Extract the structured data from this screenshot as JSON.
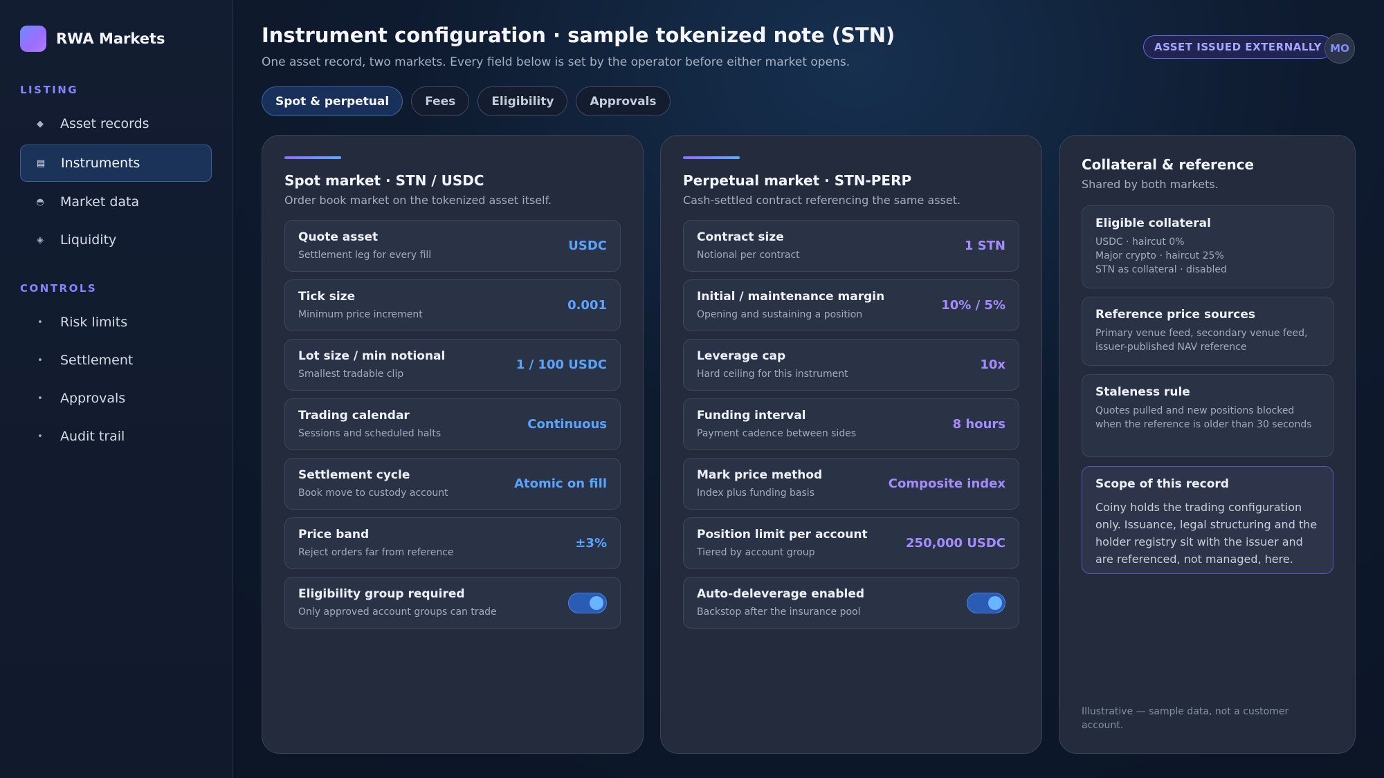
{
  "brand": {
    "name": "RWA Markets"
  },
  "sidebar": {
    "sections": [
      {
        "label": "LISTING",
        "items": [
          {
            "label": "Asset records",
            "icon": "diamond-icon"
          },
          {
            "label": "Instruments",
            "icon": "list-icon",
            "active": true
          },
          {
            "label": "Market data",
            "icon": "half-circle-icon"
          },
          {
            "label": "Liquidity",
            "icon": "diamond-outline-icon"
          }
        ]
      },
      {
        "label": "CONTROLS",
        "items": [
          {
            "label": "Risk limits",
            "icon": "dot-icon"
          },
          {
            "label": "Settlement",
            "icon": "dot-icon"
          },
          {
            "label": "Approvals",
            "icon": "dot-icon"
          },
          {
            "label": "Audit trail",
            "icon": "dot-icon"
          }
        ]
      }
    ]
  },
  "header": {
    "title": "Instrument configuration · sample tokenized note (STN)",
    "subtitle": "One asset record, two markets. Every field below is set by the operator before either market opens.",
    "badge": "ASSET ISSUED EXTERNALLY",
    "avatar": "MO"
  },
  "tabs": [
    {
      "label": "Spot & perpetual",
      "active": true
    },
    {
      "label": "Fees"
    },
    {
      "label": "Eligibility"
    },
    {
      "label": "Approvals"
    }
  ],
  "spot": {
    "title": "Spot market · STN / USDC",
    "subtitle": "Order book market on the tokenized asset itself.",
    "rows": [
      {
        "label": "Quote asset",
        "desc": "Settlement leg for every fill",
        "value": "USDC"
      },
      {
        "label": "Tick size",
        "desc": "Minimum price increment",
        "value": "0.001"
      },
      {
        "label": "Lot size / min notional",
        "desc": "Smallest tradable clip",
        "value": "1 / 100 USDC"
      },
      {
        "label": "Trading calendar",
        "desc": "Sessions and scheduled halts",
        "value": "Continuous"
      },
      {
        "label": "Settlement cycle",
        "desc": "Book move to custody account",
        "value": "Atomic on fill"
      },
      {
        "label": "Price band",
        "desc": "Reject orders far from reference",
        "value": "±3%"
      },
      {
        "label": "Eligibility group required",
        "desc": "Only approved account groups can trade",
        "toggle": true
      }
    ]
  },
  "perp": {
    "title": "Perpetual market · STN-PERP",
    "subtitle": "Cash-settled contract referencing the same asset.",
    "rows": [
      {
        "label": "Contract size",
        "desc": "Notional per contract",
        "value": "1 STN"
      },
      {
        "label": "Initial / maintenance margin",
        "desc": "Opening and sustaining a position",
        "value": "10% / 5%"
      },
      {
        "label": "Leverage cap",
        "desc": "Hard ceiling for this instrument",
        "value": "10x"
      },
      {
        "label": "Funding interval",
        "desc": "Payment cadence between sides",
        "value": "8 hours"
      },
      {
        "label": "Mark price method",
        "desc": "Index plus funding basis",
        "value": "Composite index"
      },
      {
        "label": "Position limit per account",
        "desc": "Tiered by account group",
        "value": "250,000 USDC"
      },
      {
        "label": "Auto-deleverage enabled",
        "desc": "Backstop after the insurance pool",
        "toggle": true
      }
    ]
  },
  "collateral": {
    "title": "Collateral & reference",
    "subtitle": "Shared by both markets.",
    "cards": [
      {
        "title": "Eligible collateral",
        "lines": [
          "USDC · haircut 0%",
          "Major crypto · haircut 25%",
          "STN as collateral · disabled"
        ]
      },
      {
        "title": "Reference price sources",
        "body": "Primary venue feed, secondary venue feed, issuer-published NAV reference"
      },
      {
        "title": "Staleness rule",
        "body": "Quotes pulled and new positions blocked when the reference is older than 30 seconds"
      },
      {
        "title": "Scope of this record",
        "body": "Coiny holds the trading configuration only. Issuance, legal structuring and the holder registry sit with the issuer and are referenced, not managed, here."
      }
    ],
    "footnote": "Illustrative — sample data, not a customer account."
  },
  "colors": {
    "accent_blue": "#5aa4ff",
    "accent_purple": "#a48cff",
    "badge": "#6d67e6"
  }
}
